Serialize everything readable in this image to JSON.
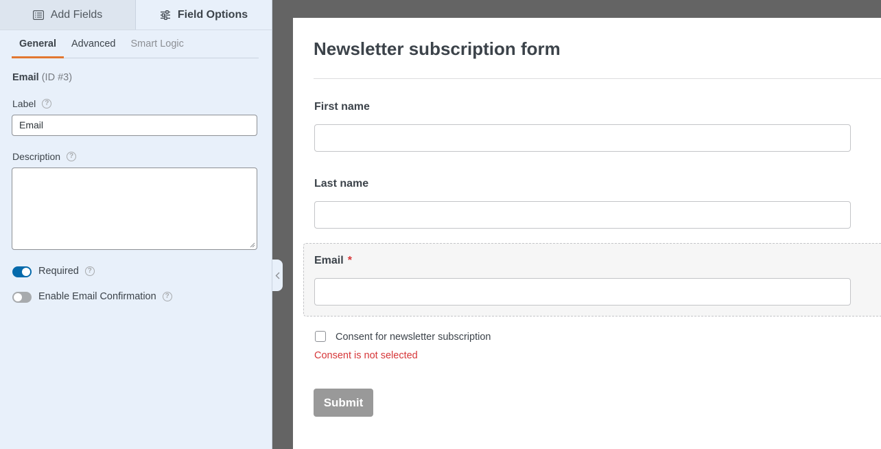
{
  "sidebar": {
    "top_tabs": [
      {
        "label": "Add Fields",
        "icon": "list-icon"
      },
      {
        "label": "Field Options",
        "icon": "sliders-icon"
      }
    ],
    "sub_tabs": [
      {
        "label": "General",
        "state": "active"
      },
      {
        "label": "Advanced",
        "state": "normal"
      },
      {
        "label": "Smart Logic",
        "state": "disabled"
      }
    ],
    "field_name": "Email",
    "field_id": "(ID #3)",
    "label_caption": "Label",
    "label_value": "Email",
    "description_caption": "Description",
    "description_value": "",
    "help_glyph": "?",
    "required_label": "Required",
    "required_on": true,
    "confirmation_label": "Enable Email Confirmation",
    "confirmation_on": false,
    "accent_color": "#e27730",
    "toggle_on_color": "#056aab"
  },
  "form": {
    "title": "Newsletter subscription form",
    "fields": [
      {
        "label": "First name",
        "required": false
      },
      {
        "label": "Last name",
        "required": false
      },
      {
        "label": "Email",
        "required": true
      }
    ],
    "required_mark": "*",
    "consent_label": "Consent for newsletter subscription",
    "consent_checked": false,
    "error_text": "Consent is not selected",
    "submit_label": "Submit",
    "error_color": "#d63638"
  }
}
